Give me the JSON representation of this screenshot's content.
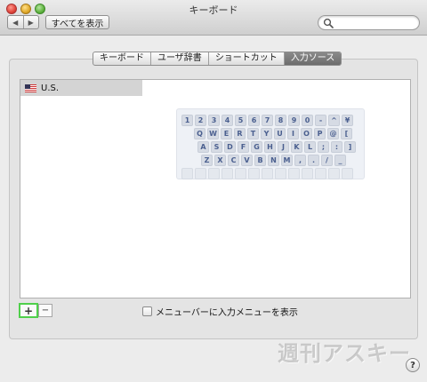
{
  "window": {
    "title": "キーボード"
  },
  "toolbar": {
    "back_icon": "◀",
    "forward_icon": "▶",
    "show_all_label": "すべてを表示",
    "search_placeholder": ""
  },
  "tabs": [
    {
      "label": "キーボード",
      "active": false
    },
    {
      "label": "ユーザ辞書",
      "active": false
    },
    {
      "label": "ショートカット",
      "active": false
    },
    {
      "label": "入力ソース",
      "active": true
    }
  ],
  "input_sources": [
    {
      "label": "U.S.",
      "icon": "us-flag-icon",
      "selected": true
    }
  ],
  "keyboard_preview": {
    "rows": [
      [
        "1",
        "2",
        "3",
        "4",
        "5",
        "6",
        "7",
        "8",
        "9",
        "0",
        "-",
        "^",
        "¥"
      ],
      [
        "Q",
        "W",
        "E",
        "R",
        "T",
        "Y",
        "U",
        "I",
        "O",
        "P",
        "@",
        "["
      ],
      [
        "A",
        "S",
        "D",
        "F",
        "G",
        "H",
        "J",
        "K",
        "L",
        ";",
        ":",
        "]"
      ],
      [
        "Z",
        "X",
        "C",
        "V",
        "B",
        "N",
        "M",
        ",",
        ".",
        "/",
        "_"
      ],
      [
        "",
        "",
        "",
        "",
        "",
        "",
        "",
        "",
        "",
        "",
        "",
        "",
        ""
      ]
    ]
  },
  "controls": {
    "add_label": "+",
    "remove_label": "−",
    "show_menu_label": "メニューバーに入力メニューを表示",
    "show_menu_checked": false,
    "help_label": "?"
  },
  "watermark": "週刊アスキー"
}
